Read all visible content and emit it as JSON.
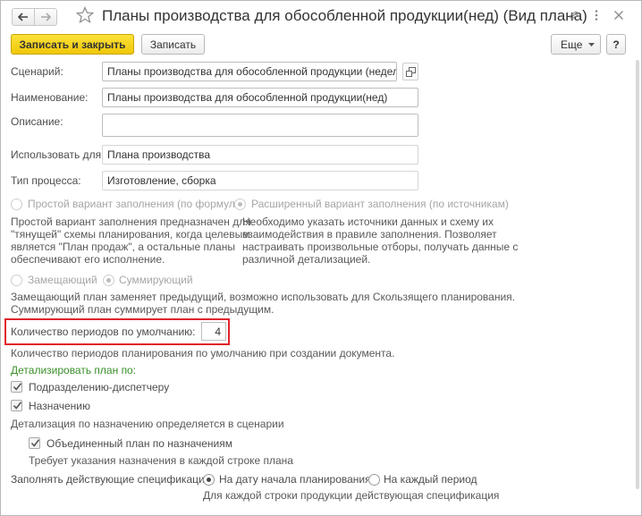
{
  "window": {
    "title": "Планы производства для обособленной продукции(нед) (Вид плана)"
  },
  "toolbar": {
    "save_close_label": "Записать и закрыть",
    "save_label": "Записать",
    "more_label": "Еще",
    "help_label": "?"
  },
  "form": {
    "scenario": {
      "label": "Сценарий:",
      "value": "Планы производства для обособленной продукции (неделя)"
    },
    "name": {
      "label": "Наименование:",
      "value": "Планы производства для обособленной продукции(нед)"
    },
    "description": {
      "label": "Описание:",
      "value": ""
    },
    "use_for": {
      "label": "Использовать для:",
      "value": "Плана производства"
    },
    "process_type": {
      "label": "Тип процесса:",
      "value": "Изготовление, сборка"
    },
    "fill_mode": {
      "simple_label": "Простой вариант заполнения (по формуле)",
      "extended_label": "Расширенный вариант заполнения (по источникам)",
      "selected": "extended",
      "simple_note_lines": [
        "Простой вариант заполнения предназначен для",
        "\"тянущей\" схемы планирования, когда целевым",
        "является \"План продаж\", а остальные планы",
        "обеспечивают его исполнение."
      ],
      "extended_note_lines": [
        "Необходимо указать источники данных и схему их",
        "взаимодействия в правиле заполнения. Позволяет",
        "настраивать произвольные отборы, получать данные с",
        "различной детализацией."
      ]
    },
    "plan_mode": {
      "replacing_label": "Замещающий",
      "summing_label": "Суммирующий",
      "selected": "summing",
      "note_lines": [
        "Замещающий план заменяет предыдущий, возможно использовать для Скользящего планирования.",
        "Суммирующий план суммирует план с предыдущим."
      ]
    },
    "periods": {
      "label": "Количество периодов по умолчанию:",
      "value": "4",
      "note": "Количество периодов планирования по умолчанию при создании документа."
    },
    "detail": {
      "heading": "Детализировать план по:",
      "dispatcher_label": "Подразделению-диспетчеру",
      "dispatcher_checked": true,
      "assignment_label": "Назначению",
      "assignment_checked": true,
      "assignment_note": "Детализация по назначению определяется в сценарии",
      "combined_label": "Объединенный план по назначениям",
      "combined_checked": true,
      "combined_note": "Требует указания назначения в каждой строке плана"
    },
    "specs": {
      "label": "Заполнять действующие спецификации:",
      "option_start": "На дату начала планирования",
      "option_each": "На каждый период",
      "selected": "start",
      "note": "Для каждой строки продукции действующая спецификация"
    }
  },
  "colors": {
    "accent_yellow": "#f5d21e",
    "highlight_red": "#e0242b",
    "section_green": "#3a8f2a"
  }
}
